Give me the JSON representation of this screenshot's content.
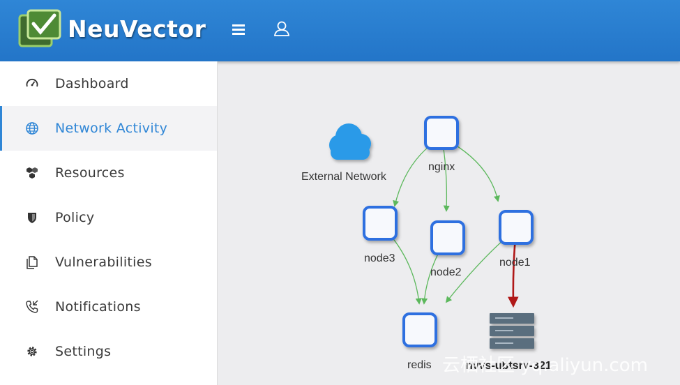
{
  "app": {
    "brand": "NeuVector"
  },
  "header": {
    "menu_icon": "hamburger-menu-icon",
    "user_icon": "user-icon"
  },
  "sidebar": {
    "items": [
      {
        "label": "Dashboard",
        "icon": "gauge-icon",
        "active": false
      },
      {
        "label": "Network Activity",
        "icon": "globe-icon",
        "active": true
      },
      {
        "label": "Resources",
        "icon": "cubes-icon",
        "active": false
      },
      {
        "label": "Policy",
        "icon": "shield-icon",
        "active": false
      },
      {
        "label": "Vulnerabilities",
        "icon": "documents-icon",
        "active": false
      },
      {
        "label": "Notifications",
        "icon": "phone-icon",
        "active": false
      },
      {
        "label": "Settings",
        "icon": "gear-icon",
        "active": false
      }
    ]
  },
  "graph": {
    "nodes": {
      "external": "External Network",
      "nginx": "nginx",
      "node3": "node3",
      "node2": "node2",
      "node1": "node1",
      "redis": "redis",
      "host": "nvvs-ubtsrv-321"
    },
    "colors": {
      "container": "#2f6fe0",
      "allowed": "#5cb85c",
      "violation": "#b01818",
      "cloud": "#2b9ae8"
    }
  },
  "watermark": "云栖社区 yq.aliyun.com"
}
